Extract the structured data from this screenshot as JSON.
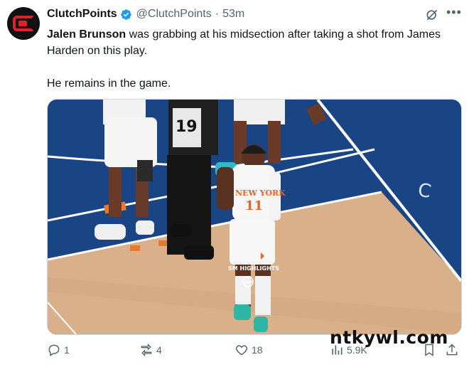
{
  "author": {
    "name": "ClutchPoints",
    "handle": "@ClutchPoints",
    "separator": "·",
    "time": "53m"
  },
  "tweet": {
    "bold_name": "Jalen Brunson",
    "text_rest": " was grabbing at his midsection after taking a shot from James Harden on this play.",
    "text_2": "He remains in the game."
  },
  "media": {
    "jersey_number": "11",
    "team_text": "NEW YORK",
    "ref_number": "19",
    "overlay_text": "SM HIGHLIGHTS",
    "overlay_logo": "SM"
  },
  "actions": {
    "reply_count": "1",
    "repost_count": "4",
    "like_count": "18",
    "views_count": "5.9K"
  },
  "watermark": "ntkywl.com",
  "colors": {
    "verified": "#1d9bf0",
    "muted": "#536471",
    "court_blue": "#1c4b8f"
  }
}
